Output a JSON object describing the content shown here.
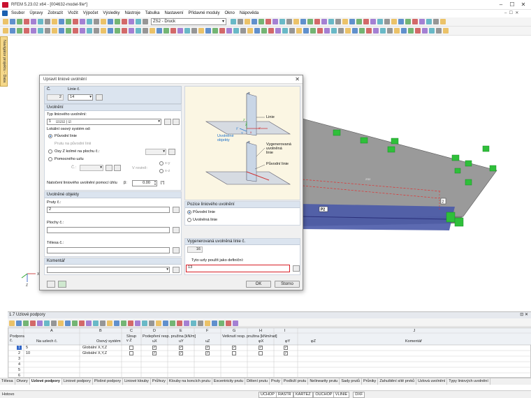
{
  "window": {
    "title": "RFEM 5.23.02 x64 - [004632-model-file*]"
  },
  "menu": [
    "Soubor",
    "Úpravy",
    "Zobrazit",
    "Vložit",
    "Výpočet",
    "Výsledky",
    "Nástroje",
    "Tabulka",
    "Nastavení",
    "Přídavné moduly",
    "Okno",
    "Nápověda"
  ],
  "toolbar": {
    "load_case_combo": "ZS2 - Druck"
  },
  "navigator_tab": "Navigátor projektu - Data",
  "model": {
    "labels": {
      "p2": "P2",
      "zs2": "ZS2",
      "node2": "2"
    }
  },
  "dialog": {
    "title": "Upravit liniové uvolnění",
    "no_label": "Č.",
    "no_value": "2",
    "line_label": "Linie č.",
    "line_value": "14",
    "release_group": "Uvolnění",
    "type_label": "Typ liniového uvolnění:",
    "type_no": "1",
    "local_axes_label": "Lokální osový systém od:",
    "opt_original_line": "Původní linie",
    "opt_member": "Prutu na původní linii",
    "opt_axis_z": "Osy Z kolmé na plochu č.:",
    "opt_helper_node": "Pomocného uzlu",
    "node_label": "Č.:",
    "plane_label": "V rovině:",
    "plane_xy": "x-y",
    "plane_xz": "x-z",
    "rotation_label": "Natočení liniového uvolnění pomocí úhlu",
    "beta_label": "β:",
    "beta_value": "0.00",
    "beta_unit": "[°]",
    "released_group": "Uvolněné objekty",
    "members_label": "Pruty č.:",
    "members_value": "2",
    "surfaces_label": "Plochy č.:",
    "surfaces_value": "",
    "solids_label": "Tělesa č.:",
    "solids_value": "",
    "comment_group": "Komentář",
    "comment_value": "",
    "diagram": {
      "line": "Linie",
      "released_objects": "Uvolněné\nobjekty",
      "generated_line": "Vygenerovaná\nuvolněná\nlinie",
      "original_line": "Původní linie",
      "axes": [
        "y'",
        "x'",
        "z'",
        "Y",
        "x",
        "z"
      ]
    },
    "position_group": "Pozice liniového uvolnění",
    "pos_original": "Původní linie",
    "pos_released": "Uvolněná linie",
    "generated_group": "Vygenerovaná uvolněná linie č.",
    "generated_value": "16",
    "nodes_def_label": "Tyto uzly použít jako definiční:",
    "nodes_def_value": "13",
    "ok": "OK",
    "cancel": "Storno"
  },
  "table": {
    "title": "1.7 Uzlové podpory",
    "col_letters": [
      "A",
      "B",
      "C",
      "D",
      "E",
      "F",
      "G",
      "H",
      "I",
      "J"
    ],
    "headers": {
      "support": "Podpora\nč.",
      "nodes": "Na uzlech č.",
      "axis": "Osový systém",
      "column": "Sloup\nv Z",
      "spring_group": "Podepření resp. pružina [kN/m]",
      "ux": "uX",
      "uy": "uY",
      "uz": "uZ",
      "rot_group": "Vetknutí resp. pružina [kNm/rad]",
      "phx": "φX",
      "phy": "φY",
      "phz": "φZ",
      "comment": "Komentář"
    },
    "rows": [
      {
        "no": "1",
        "nodes": "5",
        "axis": "Globální X,Y,Z",
        "col": false,
        "ux": true,
        "uy": true,
        "uz": true,
        "px": true,
        "py": true,
        "pz": true
      },
      {
        "no": "2",
        "nodes": "10",
        "axis": "Globální X,Y,Z",
        "col": false,
        "ux": true,
        "uy": true,
        "uz": true,
        "px": false,
        "py": false,
        "pz": true
      },
      {
        "no": "3"
      },
      {
        "no": "4"
      },
      {
        "no": "5"
      },
      {
        "no": "6"
      }
    ]
  },
  "tabs": [
    "Tělesa",
    "Otvory",
    "Uzlové podpory",
    "Liniové podpory",
    "Plošné podpory",
    "Liniové klouby",
    "Průřezy",
    "Klouby na koncích prutu",
    "Excentricity prutu",
    "Dělení prutu",
    "Pruty",
    "Podloží prutu",
    "Nelinearity prutu",
    "Sady prutů",
    "Průniky",
    "Zahuštění sítě prvků",
    "Uzlová uvolnění",
    "Typy liniových uvolnění"
  ],
  "status": {
    "text": "Hotovo",
    "buttons": [
      "UCHOP",
      "RASTR",
      "KARTEZ",
      "OUCHOP",
      "VLINIE",
      "DXF"
    ]
  }
}
